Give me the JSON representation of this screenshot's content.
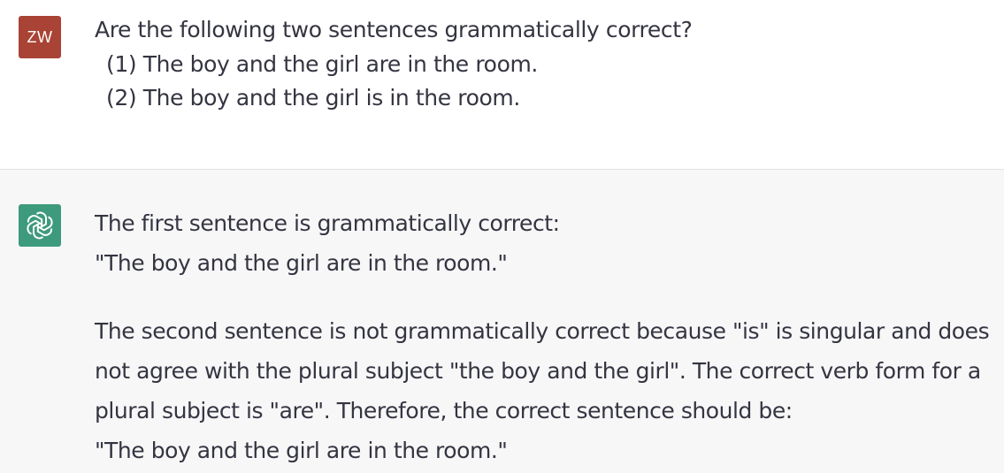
{
  "user_message": {
    "avatar_initials": "ZW",
    "avatar_color": "#a94335",
    "question": "Are the following two sentences grammatically correct?",
    "items": [
      "(1)  The boy and the girl are in the room.",
      "(2)  The boy and the girl is in the room."
    ]
  },
  "assistant_message": {
    "avatar_icon": "openai-logo-icon",
    "avatar_color": "#19c37d",
    "paragraph1": [
      "The first sentence is grammatically correct:",
      "\"The boy and the girl are in the room.\""
    ],
    "paragraph2": [
      "The second sentence is not grammatically correct because \"is\" is singular and does",
      "not agree with the plural subject \"the boy and the girl\". The correct verb form for a",
      "plural subject is \"are\". Therefore, the correct sentence should be:",
      "\"The boy and the girl are in the room.\""
    ]
  }
}
